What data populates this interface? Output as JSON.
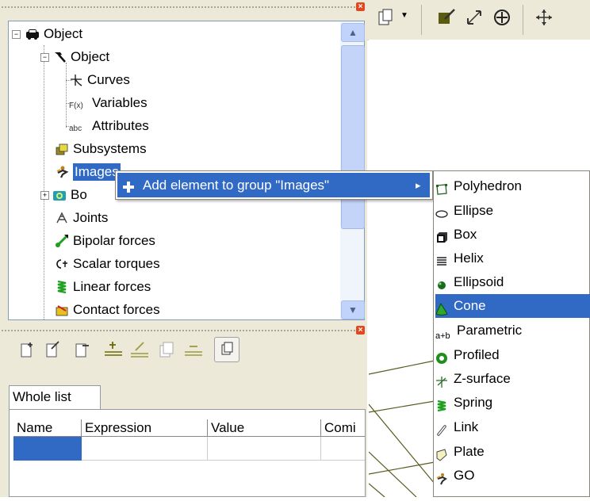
{
  "tree": {
    "items": [
      {
        "label": "Object",
        "icon": "car-icon"
      },
      {
        "label": "Object",
        "icon": "hammer-icon"
      },
      {
        "label": "Curves",
        "icon": "curve-icon"
      },
      {
        "label": "Variables",
        "icon": "fx-icon"
      },
      {
        "label": "Attributes",
        "icon": "abc-icon"
      },
      {
        "label": "Subsystems",
        "icon": "subsystem-icon"
      },
      {
        "label": "Images",
        "icon": "image-figure-icon"
      },
      {
        "label": "Bo",
        "icon": "bodies-icon"
      },
      {
        "label": "Joints",
        "icon": "joint-icon"
      },
      {
        "label": "Bipolar forces",
        "icon": "bipolar-force-icon"
      },
      {
        "label": "Scalar torques",
        "icon": "scalar-torque-icon"
      },
      {
        "label": "Linear forces",
        "icon": "spring-force-icon"
      },
      {
        "label": "Contact forces",
        "icon": "contact-force-icon"
      }
    ],
    "vars_prefix": "F(x)",
    "attr_prefix": "abc"
  },
  "context_menu": {
    "item_label": "Add element to group \"Images\"",
    "arrow": "▸"
  },
  "submenu": {
    "items": [
      {
        "label": "Polyhedron",
        "icon": "polyhedron-icon"
      },
      {
        "label": "Ellipse",
        "icon": "ellipse-icon"
      },
      {
        "label": "Box",
        "icon": "box-icon"
      },
      {
        "label": "Helix",
        "icon": "helix-icon"
      },
      {
        "label": "Ellipsoid",
        "icon": "ellipsoid-icon"
      },
      {
        "label": "Cone",
        "icon": "cone-icon",
        "selected": true
      },
      {
        "label": "Parametric",
        "icon": "parametric-icon"
      },
      {
        "label": "Profiled",
        "icon": "profiled-icon"
      },
      {
        "label": "Z-surface",
        "icon": "z-surface-icon"
      },
      {
        "label": "Spring",
        "icon": "spring-icon"
      },
      {
        "label": "Link",
        "icon": "link-icon"
      },
      {
        "label": "Plate",
        "icon": "plate-icon"
      },
      {
        "label": "GO",
        "icon": "go-icon"
      }
    ],
    "parametric_prefix": "a+b"
  },
  "expressions": {
    "tab_label": "Whole list",
    "columns": [
      "Name",
      "Expression",
      "Value",
      "Comi"
    ]
  },
  "colors": {
    "selection": "#316ac5",
    "panel": "#ece9d8"
  }
}
